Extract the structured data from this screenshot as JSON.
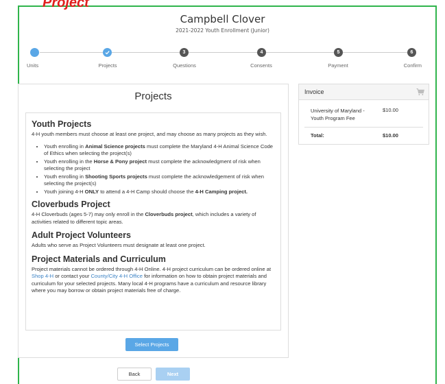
{
  "overlay_label": "Project",
  "header": {
    "name": "Campbell Clover",
    "subtitle": "2021-2022 Youth Enrollment (Junior)"
  },
  "steps": [
    {
      "label": "Units",
      "number": "",
      "state": "complete"
    },
    {
      "label": "Projects",
      "number": "",
      "state": "current"
    },
    {
      "label": "Questions",
      "number": "3",
      "state": "pending"
    },
    {
      "label": "Consents",
      "number": "4",
      "state": "pending"
    },
    {
      "label": "Payment",
      "number": "5",
      "state": "pending"
    },
    {
      "label": "Confirm",
      "number": "6",
      "state": "pending"
    }
  ],
  "projects_panel": {
    "title": "Projects",
    "youth": {
      "heading": "Youth Projects",
      "intro": "4-H youth members must choose at least one project, and may choose as many projects as they wish.",
      "bullets": [
        {
          "pre": "Youth enrolling in ",
          "bold": "Animal Science projects",
          "post": " must complete the Maryland 4-H Animal Science Code of Ethics when selecting the project(s)"
        },
        {
          "pre": "Youth enrolling in the ",
          "bold": "Horse & Pony project",
          "post": " must complete the acknowledgment of risk when selecting the project"
        },
        {
          "pre": "Youth enrolling in ",
          "bold": "Shooting Sports projects",
          "post": " must complete the acknowledgement of risk when selecting the project(s)"
        },
        {
          "pre": "Youth joining 4-H ",
          "bold": "ONLY",
          "post": " to attend a 4-H Camp should choose the ",
          "bold2": "4-H Camping project."
        }
      ]
    },
    "cloverbuds": {
      "heading": "Cloverbuds Project",
      "pre": "4-H Cloverbuds (ages 5-7) may only enroll in the ",
      "bold": "Cloverbuds project",
      "post": ", which includes a variety of activities related to different topic areas."
    },
    "adult": {
      "heading": "Adult Project Volunteers",
      "text": "Adults who serve as Project Volunteers must designate at least one project."
    },
    "materials": {
      "heading": "Project Materials and Curriculum",
      "t1": "Project materials cannot be ordered through 4-H Online.   4-H project curriculum can be ordered online at ",
      "link1": "Shop 4-H",
      "t2": " or contact your ",
      "link2": "County/City 4-H Office",
      "t3": " for information on how to obtain project materials and curriculum for your selected projects.   Many local 4-H programs have a curriculum and resource library where you may borrow or obtain project materials free of charge."
    },
    "select_button": "Select Projects"
  },
  "nav": {
    "back": "Back",
    "next": "Next"
  },
  "invoice": {
    "title": "Invoice",
    "cart_icon": "cart-icon",
    "item_name": "University of Maryland - Youth Program Fee",
    "item_amount": "$10.00",
    "total_label": "Total:",
    "total_amount": "$10.00"
  },
  "colors": {
    "frame": "#2fb44b",
    "accent": "#5aa7e6",
    "overlay_text": "#e0201e",
    "link": "#3b82c4"
  }
}
